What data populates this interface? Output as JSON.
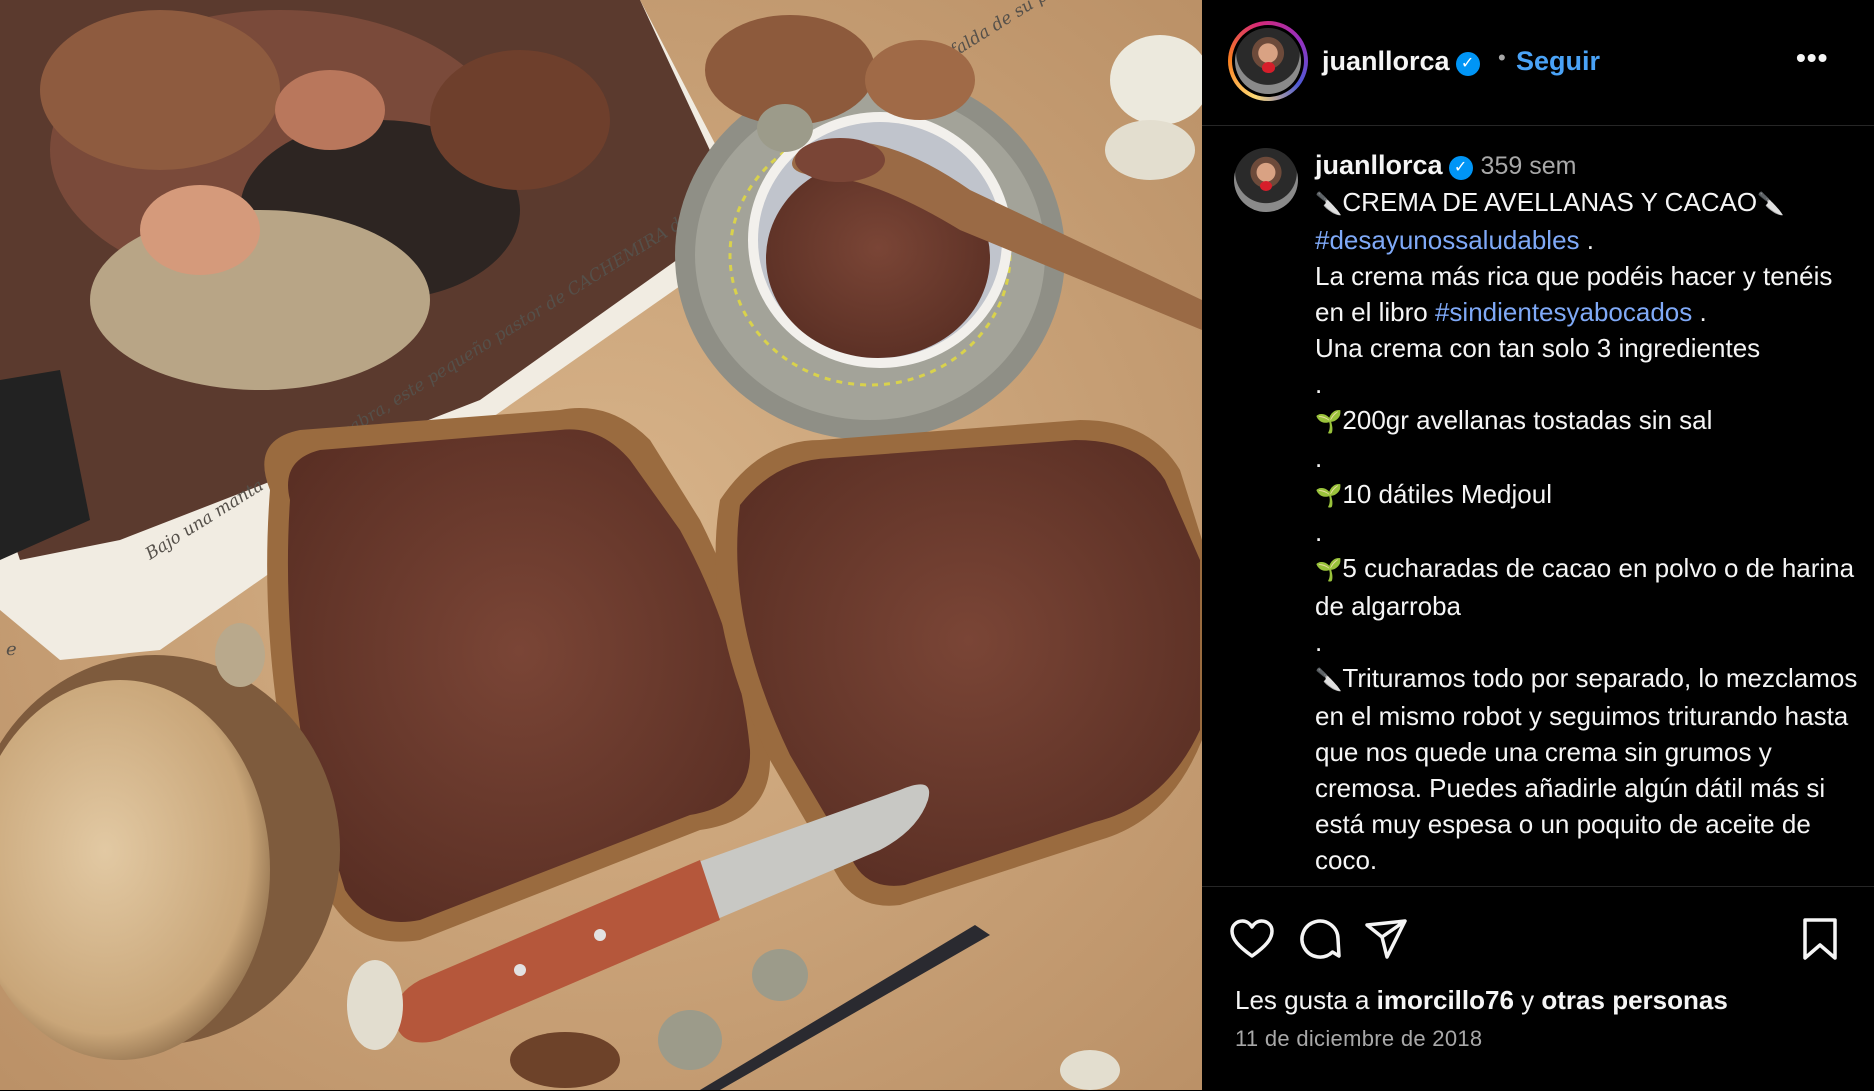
{
  "photo": {
    "book_caption": "Bajo una manta de piel de cabra, este pequeño pastor de CACHEMIRA descansa con la cabeza apoyada en la falda de su padre.",
    "book_letter": "e"
  },
  "header": {
    "username": "juanllorca",
    "verified_glyph": "✓",
    "separator": "•",
    "follow_label": "Seguir",
    "more_glyph": "•••"
  },
  "post": {
    "username": "juanllorca",
    "verified_glyph": "✓",
    "time_ago": "359 sem",
    "knife_glyph": "🔪",
    "sprout_glyph": "🌱",
    "title": "CREMA DE AVELLANAS Y CACAO",
    "hashtag_1": "#desayunossaludables",
    "hashtag_1_after": " .",
    "intro_text": "La crema más rica que podéis hacer y tenéis en el libro ",
    "hashtag_2": "#sindientesyabocados",
    "hashtag_2_after": " .",
    "intro_text_2": "Una crema con tan solo 3 ingredientes",
    "separator_dot": ".",
    "ingredient_1": "200gr avellanas tostadas sin sal",
    "ingredient_2": "10 dátiles Medjoul",
    "ingredient_3": "5 cucharadas de cacao en polvo o de harina de algarroba",
    "method": "Trituramos todo por separado, lo mezclamos en el mismo robot y seguimos triturando hasta que nos quede una crema sin grumos y cremosa. Puedes añadirle algún dátil más si está muy espesa o un poquito de aceite de coco."
  },
  "actions": {
    "likes_prefix": "Les gusta a ",
    "likes_user": "imorcillo76",
    "likes_middle": " y ",
    "likes_suffix": "otras personas",
    "date": "11 de diciembre de 2018"
  },
  "colors": {
    "background": "#000000",
    "link_blue": "#4aa3f7",
    "hashtag_blue": "#7fa9f7",
    "verified_blue": "#0095f6",
    "muted_text": "#a8a8a8"
  },
  "icons": [
    "heart-icon",
    "comment-icon",
    "share-icon",
    "bookmark-icon",
    "verified-badge-icon",
    "more-options-icon"
  ]
}
